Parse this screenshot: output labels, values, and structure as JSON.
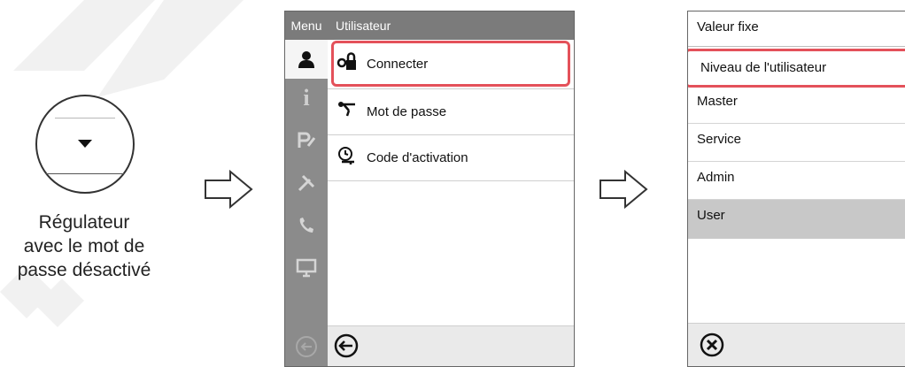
{
  "caption": {
    "line1": "Régulateur",
    "line2": "avec le mot de",
    "line3": "passe désactivé"
  },
  "screen1": {
    "menu_label": "Menu",
    "header_title": "Utilisateur",
    "items": [
      {
        "label": "Connecter",
        "icon": "lock-key-icon"
      },
      {
        "label": "Mot de passe",
        "icon": "key-wand-icon"
      },
      {
        "label": "Code d'activation",
        "icon": "clock-key-icon"
      }
    ],
    "rail_icons": [
      "user-icon",
      "info-icon",
      "graph-pen-icon",
      "tools-icon",
      "phone-icon",
      "monitor-icon",
      "back-icon"
    ]
  },
  "screen2": {
    "title": "Valeur fixe",
    "field_value": "Niveau de l'utilisateur",
    "options": [
      "Master",
      "Service",
      "Admin",
      "User"
    ],
    "selected": "User"
  },
  "colors": {
    "highlight": "#e4515a",
    "rail": "#8b8b8b",
    "header": "#7b7b7b",
    "selected_row": "#c8c8c8"
  }
}
